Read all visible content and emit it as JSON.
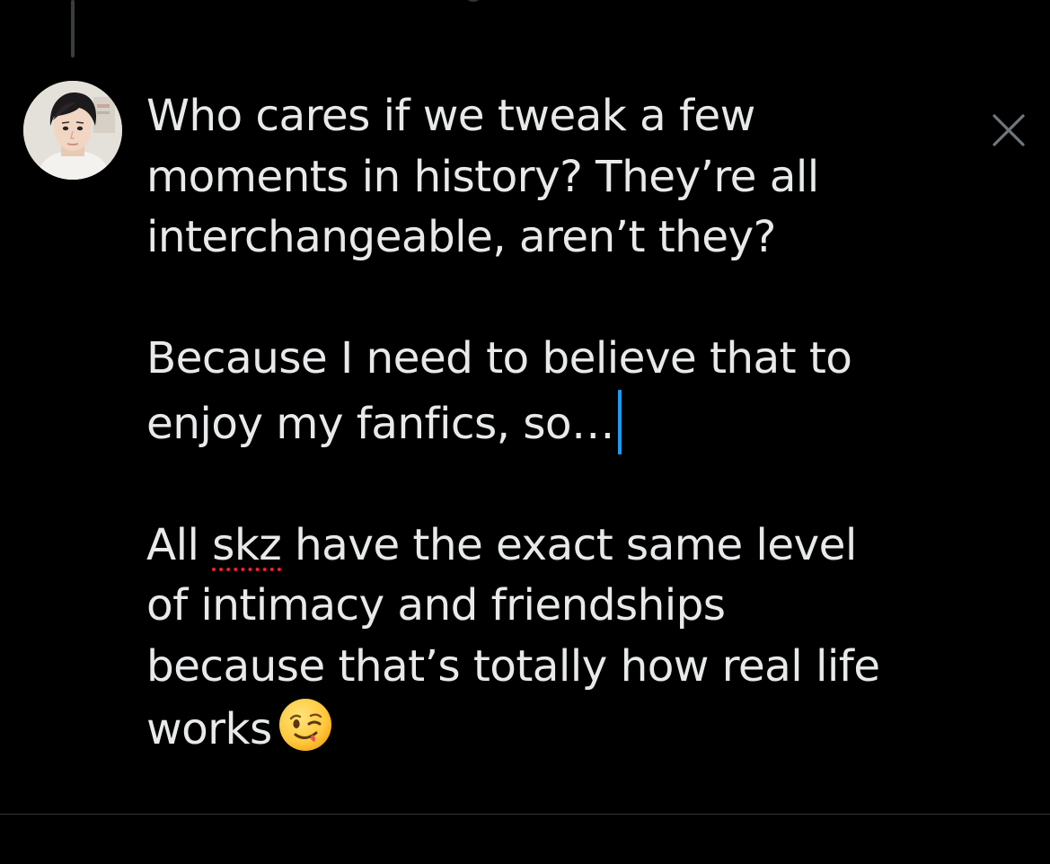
{
  "compose": {
    "paragraph1": {
      "line1": "Who cares if we tweak a few",
      "line2": "moments in history? They’re all",
      "line3": "interchangeable, aren’t they?"
    },
    "paragraph2": {
      "line1": "Because I need to believe that to",
      "line2": "enjoy my fanfics, so…"
    },
    "paragraph3": {
      "line1_before": "All ",
      "line1_misspelled": "skz",
      "line1_after": " have the exact same level",
      "line2": "of intimacy and friendships",
      "line3": "because that’s totally how real life",
      "line4": "works"
    },
    "emoji": "winking-face-emoji"
  },
  "colors": {
    "background": "#000000",
    "text": "#e7e9ea",
    "cursor": "#1d9bf0",
    "spellcheck": "#f4212e",
    "divider": "#2f3336",
    "icon": "#71767b"
  },
  "icons": {
    "close": "close-icon",
    "avatar": "user-avatar"
  }
}
